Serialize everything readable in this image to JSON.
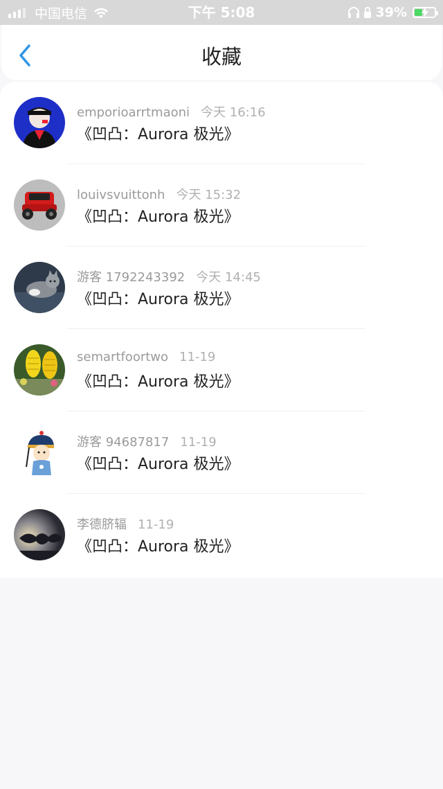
{
  "status_bar": {
    "carrier": "中国电信",
    "time": "下午 5:08",
    "battery": "39%",
    "battery_level": 0.39
  },
  "nav": {
    "back_icon": "chevron-left-icon",
    "title": "收藏",
    "accent_color": "#2f95e5"
  },
  "favorites": [
    {
      "user": "emporioarrtmaoni",
      "time": "今天 16:16",
      "title": "《凹凸：Aurora 极光》"
    },
    {
      "user": "louivsvuittonh",
      "time": "今天 15:32",
      "title": "《凹凸：Aurora 极光》"
    },
    {
      "user": "游客 1792243392",
      "time": "今天 14:45",
      "title": "《凹凸：Aurora 极光》"
    },
    {
      "user": "semartfoortwo",
      "time": "11-19",
      "title": "《凹凸：Aurora 极光》"
    },
    {
      "user": "游客 94687817",
      "time": "11-19",
      "title": "《凹凸：Aurora 极光》"
    },
    {
      "user": "李德脐辐",
      "time": "11-19",
      "title": "《凹凸：Aurora 极光》"
    }
  ]
}
